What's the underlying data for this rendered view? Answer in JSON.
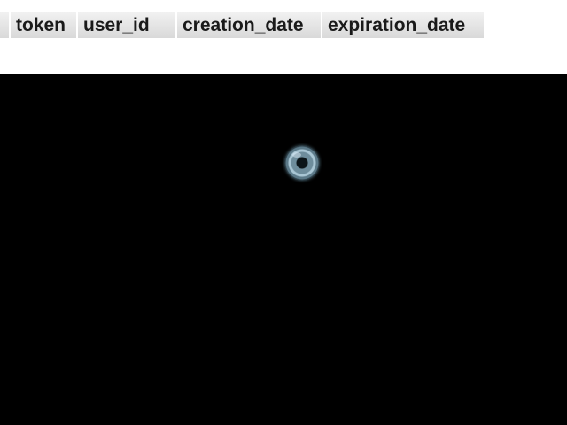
{
  "table": {
    "columns": [
      "token",
      "user_id",
      "creation_date",
      "expiration_date"
    ]
  },
  "loader": {
    "icon": "loading-spinner-icon"
  },
  "colors": {
    "background_top": "#ffffff",
    "background_bottom": "#000000",
    "header_text": "#1a1a1a"
  }
}
